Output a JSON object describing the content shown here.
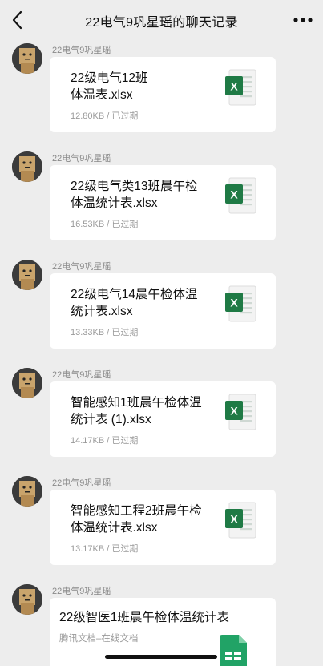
{
  "header": {
    "title": "22电气9巩星瑶的聊天记录"
  },
  "messages": [
    {
      "sender": "22电气9巩星瑶",
      "file_name": "22级电气12班\n体温表.xlsx",
      "meta": "12.80KB / 已过期"
    },
    {
      "sender": "22电气9巩星瑶",
      "file_name": "22级电气类13班晨午检\n体温统计表.xlsx",
      "meta": "16.53KB / 已过期"
    },
    {
      "sender": "22电气9巩星瑶",
      "file_name": "22级电气14晨午检体温\n统计表.xlsx",
      "meta": "13.33KB / 已过期"
    },
    {
      "sender": "22电气9巩星瑶",
      "file_name": "智能感知1班晨午检体温\n统计表 (1).xlsx",
      "meta": "14.17KB / 已过期"
    },
    {
      "sender": "22电气9巩星瑶",
      "file_name": "智能感知工程2班晨午检\n体温统计表.xlsx",
      "meta": "13.17KB / 已过期"
    }
  ],
  "doc_message": {
    "sender": "22电气9巩星瑶",
    "title": "22级智医1班晨午检体温统计表",
    "subtitle": "腾讯文档–在线文档"
  },
  "colors": {
    "background": "#ededed",
    "excel_green": "#1f7a45",
    "sheet_green": "#21a366"
  },
  "icons": [
    "back-arrow-icon",
    "more-icon",
    "excel-file-icon",
    "tencent-sheet-icon"
  ]
}
